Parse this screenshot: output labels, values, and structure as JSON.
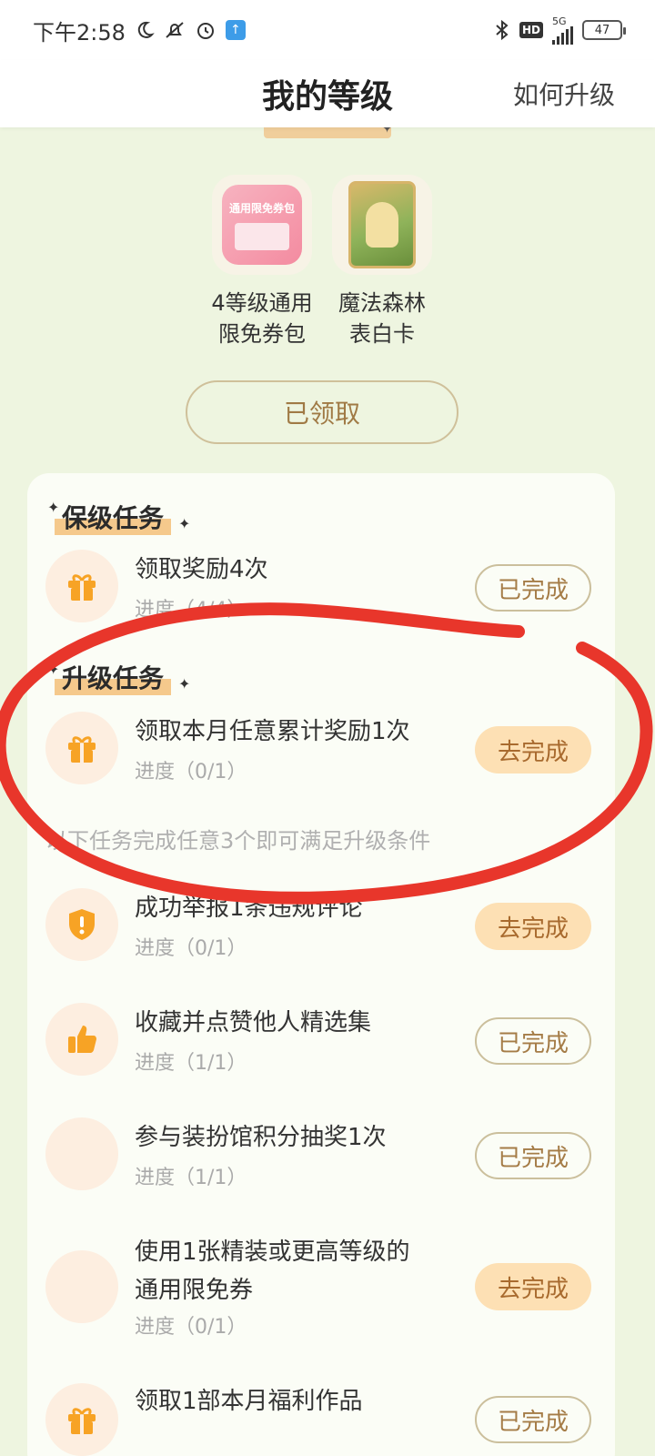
{
  "status_bar": {
    "time": "下午2:58",
    "network": "5G",
    "hd": "HD",
    "battery": "47"
  },
  "header": {
    "title": "我的等级",
    "link": "如何升级"
  },
  "rewards": {
    "items": [
      {
        "label_line1": "4等级通用",
        "label_line2": "限免券包",
        "thumb_text": "通用限免券包"
      },
      {
        "label_line1": "魔法森林",
        "label_line2": "表白卡"
      }
    ],
    "claimed_button": "已领取"
  },
  "maintain_section": {
    "title": "保级任务",
    "tasks": [
      {
        "name": "领取奖励4次",
        "progress": "进度（4/4）",
        "button": "已完成"
      }
    ]
  },
  "upgrade_section": {
    "title": "升级任务",
    "tasks": [
      {
        "name": "领取本月任意累计奖励1次",
        "progress": "进度（0/1）",
        "button": "去完成"
      }
    ],
    "hint": "以下任务完成任意3个即可满足升级条件",
    "optional_tasks": [
      {
        "name": "成功举报1条违规评论",
        "progress": "进度（0/1）",
        "button": "去完成"
      },
      {
        "name": "收藏并点赞他人精选集",
        "progress": "进度（1/1）",
        "button": "已完成"
      },
      {
        "name": "参与装扮馆积分抽奖1次",
        "progress": "进度（1/1）",
        "button": "已完成"
      },
      {
        "name_line1": "使用1张精装或更高等级的",
        "name_line2": "通用限免券",
        "progress": "进度（0/1）",
        "button": "去完成"
      },
      {
        "name": "领取1部本月福利作品",
        "button": "已完成"
      }
    ]
  },
  "colors": {
    "page_bg": "#eef5e0",
    "accent_orange": "#f7a325",
    "go_button_bg": "#fde0b4",
    "annotation_red": "#e8362b"
  }
}
